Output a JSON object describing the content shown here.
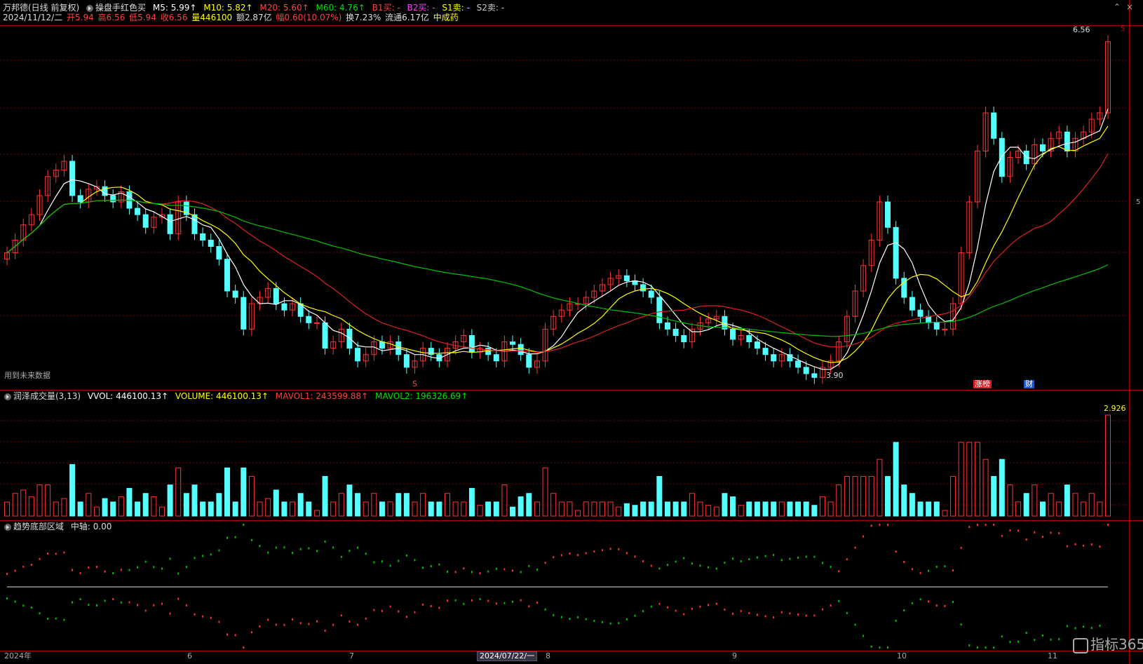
{
  "header": {
    "stock": "万邦德(日线 前复权)",
    "indicator": "操盘手红色买",
    "ma5": "M5: 5.99↑",
    "ma10": "M10: 5.82↑",
    "ma20": "M20: 5.60↑",
    "ma60": "M60: 4.76↑",
    "b1": "B1买: -",
    "b2": "B2买: -",
    "s1": "S1卖: -",
    "s2": "S2卖: -"
  },
  "quote": {
    "date": "2024/11/12/二",
    "open": "开5.94",
    "high": "高6.56",
    "low": "低5.94",
    "close": "收6.56",
    "volume": "量446100",
    "amount": "额2.87亿",
    "change": "幅0.60(10.07%)",
    "turnover": "换7.23%",
    "float": "流通6.17亿",
    "sector": "中成药"
  },
  "main_panel": {
    "future_data_note": "用到未来数据",
    "high_label": "6.56",
    "low_label": "3.90",
    "marker_s": "S",
    "badge_limit": "涨榜",
    "badge_fin": "财",
    "right_edge_label": "5"
  },
  "volume_panel": {
    "name": "润泽成交量(3,13)",
    "vvol": "VVOL: 446100.13↑",
    "volume": "VOLUME: 446100.13↑",
    "mavol1": "MAVOL1: 243599.88↑",
    "mavol2": "MAVOL2: 196326.69↑",
    "max_label": "2.926"
  },
  "trend_panel": {
    "name": "趋势底部区域",
    "axis": "中轴: 0.00"
  },
  "x_axis": [
    "2024年",
    "6",
    "7",
    "2024/07/22/一",
    "8",
    "9",
    "10",
    "11"
  ],
  "brand": "指标365",
  "colors": {
    "up": "#ff3232",
    "down": "#54ffff",
    "ma5": "#ffffff",
    "ma10": "#ffff00",
    "ma20": "#e02020",
    "ma60": "#00c000",
    "sell_mark": "#ffff00",
    "buy_mark": "#ff40ff"
  },
  "chart_data": {
    "type": "candlestick",
    "y_range": [
      3.9,
      6.56
    ],
    "closes": [
      4.9,
      5.0,
      5.12,
      5.2,
      5.35,
      5.5,
      5.55,
      5.62,
      5.35,
      5.3,
      5.4,
      5.42,
      5.35,
      5.3,
      5.38,
      5.25,
      5.2,
      5.1,
      5.18,
      5.2,
      5.05,
      5.3,
      5.2,
      5.05,
      5.0,
      4.95,
      4.85,
      4.6,
      4.55,
      4.3,
      4.5,
      4.55,
      4.62,
      4.5,
      4.45,
      4.5,
      4.4,
      4.35,
      4.35,
      4.15,
      4.2,
      4.3,
      4.15,
      4.05,
      4.1,
      4.2,
      4.15,
      4.2,
      4.1,
      4.0,
      4.05,
      4.15,
      4.1,
      4.05,
      4.15,
      4.2,
      4.25,
      4.12,
      4.15,
      4.1,
      4.05,
      4.2,
      4.18,
      4.1,
      4.0,
      4.05,
      4.3,
      4.4,
      4.45,
      4.5,
      4.5,
      4.55,
      4.6,
      4.65,
      4.7,
      4.72,
      4.68,
      4.65,
      4.6,
      4.55,
      4.35,
      4.3,
      4.25,
      4.2,
      4.3,
      4.35,
      4.38,
      4.4,
      4.3,
      4.22,
      4.25,
      4.2,
      4.15,
      4.1,
      4.05,
      4.1,
      4.05,
      4.0,
      3.95,
      3.92,
      4.0,
      4.05,
      4.2,
      4.4,
      4.6,
      4.8,
      5.0,
      5.3,
      5.1,
      4.7,
      4.55,
      4.45,
      4.4,
      4.35,
      4.3,
      4.3,
      4.5,
      4.9,
      5.3,
      5.7,
      6.0,
      5.8,
      5.5,
      5.65,
      5.7,
      5.6,
      5.75,
      5.7,
      5.8,
      5.85,
      5.7,
      5.8,
      5.85,
      5.95,
      6.0,
      6.56
    ]
  }
}
